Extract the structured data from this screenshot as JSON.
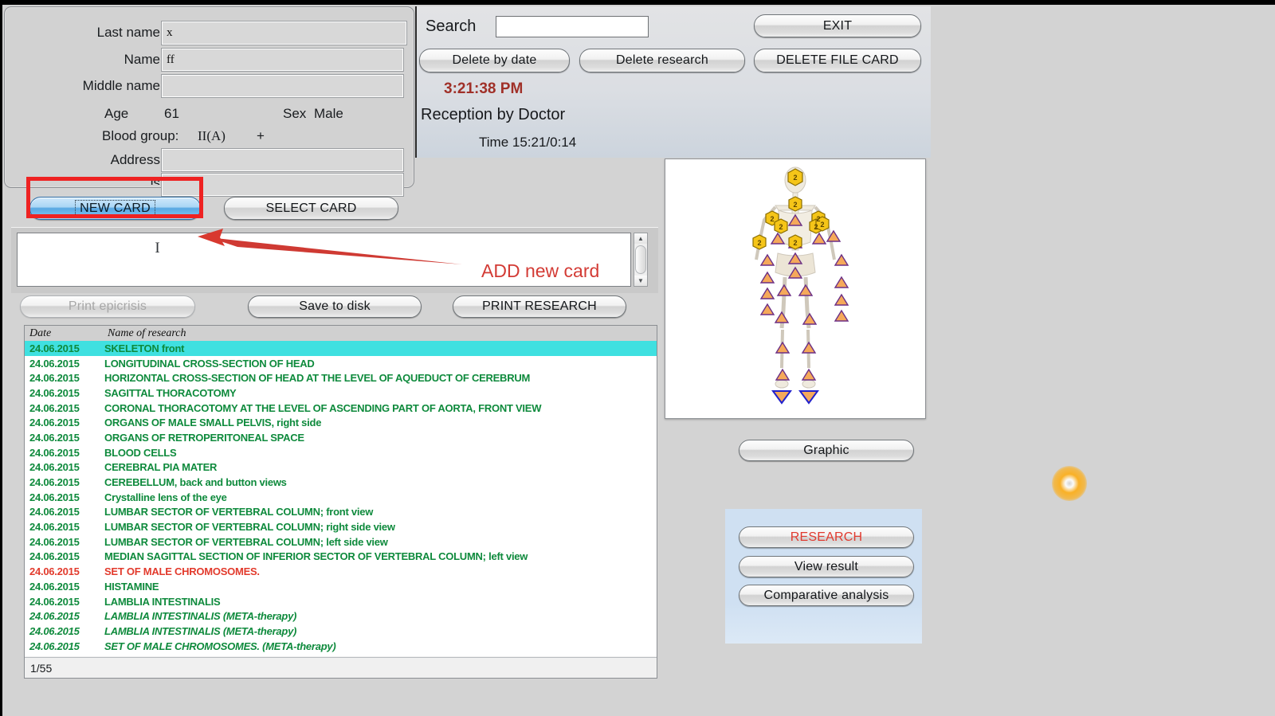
{
  "card_form": {
    "fields": [
      {
        "label": "Last name",
        "value": "x"
      },
      {
        "label": "Name",
        "value": "ff"
      },
      {
        "label": "Middle name",
        "value": ""
      },
      {
        "label": "Address",
        "value": ""
      },
      {
        "label": "is",
        "value": ""
      }
    ],
    "age_label": "Age",
    "age_value": "61",
    "sex_label": "Sex",
    "sex_value": "Male",
    "blood_group_label": "Blood group:",
    "blood_group_value": "II(A)",
    "rhesus_value": "+"
  },
  "search": {
    "label": "Search",
    "value": "",
    "placeholder": ""
  },
  "toolbar": {
    "exit": "EXIT",
    "delete_by_date": "Delete by date",
    "delete_research": "Delete research",
    "delete_file_card": "DELETE FILE CARD"
  },
  "session": {
    "clock": "3:21:38 PM",
    "reception": "Reception by Doctor",
    "time_line": "Time 15:21/0:14"
  },
  "card_buttons": {
    "new_card": "NEW CARD",
    "select_card": "SELECT CARD"
  },
  "editor": {
    "text": ""
  },
  "doc_buttons": {
    "print_epicrisis": "Print epicrisis",
    "save_to_disk": "Save to disk",
    "print_research": "PRINT RESEARCH"
  },
  "research_list": {
    "columns": [
      "Date",
      "Name of research"
    ],
    "rows": [
      {
        "date": "24.06.2015",
        "name": "SKELETON front",
        "selected": true,
        "color": "green",
        "italic": false
      },
      {
        "date": "24.06.2015",
        "name": "LONGITUDINAL CROSS-SECTION OF HEAD",
        "selected": false,
        "color": "green",
        "italic": false
      },
      {
        "date": "24.06.2015",
        "name": "HORIZONTAL CROSS-SECTION OF HEAD AT THE LEVEL OF AQUEDUCT OF CEREBRUM",
        "selected": false,
        "color": "green",
        "italic": false
      },
      {
        "date": "24.06.2015",
        "name": "SAGITTAL THORACOTOMY",
        "selected": false,
        "color": "green",
        "italic": false
      },
      {
        "date": "24.06.2015",
        "name": "CORONAL THORACOTOMY AT THE LEVEL OF ASCENDING PART OF AORTA, FRONT VIEW",
        "selected": false,
        "color": "green",
        "italic": false
      },
      {
        "date": "24.06.2015",
        "name": "ORGANS OF MALE SMALL PELVIS, right side",
        "selected": false,
        "color": "green",
        "italic": false
      },
      {
        "date": "24.06.2015",
        "name": "ORGANS OF RETROPERITONEAL SPACE",
        "selected": false,
        "color": "green",
        "italic": false
      },
      {
        "date": "24.06.2015",
        "name": "BLOOD  CELLS",
        "selected": false,
        "color": "green",
        "italic": false
      },
      {
        "date": "24.06.2015",
        "name": "CEREBRAL  PIA  MATER",
        "selected": false,
        "color": "green",
        "italic": false
      },
      {
        "date": "24.06.2015",
        "name": "CEREBELLUM,  back  and button  views",
        "selected": false,
        "color": "green",
        "italic": false
      },
      {
        "date": "24.06.2015",
        "name": "Crystalline lens of the eye",
        "selected": false,
        "color": "green",
        "italic": false
      },
      {
        "date": "24.06.2015",
        "name": "LUMBAR  SECTOR  OF  VERTEBRAL  COLUMN; front view",
        "selected": false,
        "color": "green",
        "italic": false
      },
      {
        "date": "24.06.2015",
        "name": "LUMBAR  SECTOR  OF  VERTEBRAL  COLUMN; right side view",
        "selected": false,
        "color": "green",
        "italic": false
      },
      {
        "date": "24.06.2015",
        "name": "LUMBAR  SECTOR  OF  VERTEBRAL  COLUMN; left side view",
        "selected": false,
        "color": "green",
        "italic": false
      },
      {
        "date": "24.06.2015",
        "name": "MEDIAN SAGITTAL SECTION OF INFERIOR SECTOR OF VERTEBRAL COLUMN; left view",
        "selected": false,
        "color": "green",
        "italic": false
      },
      {
        "date": "24.06.2015",
        "name": "SET OF MALE CHROMOSOMES.",
        "selected": false,
        "color": "red",
        "italic": false
      },
      {
        "date": "24.06.2015",
        "name": "HISTAMINE",
        "selected": false,
        "color": "green",
        "italic": false
      },
      {
        "date": "24.06.2015",
        "name": "LAMBLIA  INTESTINALIS",
        "selected": false,
        "color": "green",
        "italic": false
      },
      {
        "date": "24.06.2015",
        "name": "LAMBLIA  INTESTINALIS (META-therapy)",
        "selected": false,
        "color": "green",
        "italic": true
      },
      {
        "date": "24.06.2015",
        "name": "LAMBLIA  INTESTINALIS (META-therapy)",
        "selected": false,
        "color": "green",
        "italic": true
      },
      {
        "date": "24.06.2015",
        "name": "SET OF MALE CHROMOSOMES. (META-therapy)",
        "selected": false,
        "color": "green",
        "italic": true
      }
    ],
    "status": "1/55"
  },
  "right_panel": {
    "graphic": "Graphic",
    "research": "RESEARCH",
    "view_result": "View result",
    "comparative_analysis": "Comparative analysis"
  },
  "annotations": {
    "add_new_card": "ADD new card"
  },
  "colors": {
    "background": "#d3d3d3",
    "selection": "#3fe0e0",
    "list_green": "#0e8a3c",
    "list_red": "#e23a2c",
    "clock_red": "#a03028",
    "annotation_red": "#ee2222",
    "cursor_orange": "#fab023",
    "accent_blue": "#5aa8e2"
  },
  "body_map": {
    "marker_label": "2",
    "hex_markers": 9,
    "triangle_markers": 27,
    "foot_markers": 2
  }
}
